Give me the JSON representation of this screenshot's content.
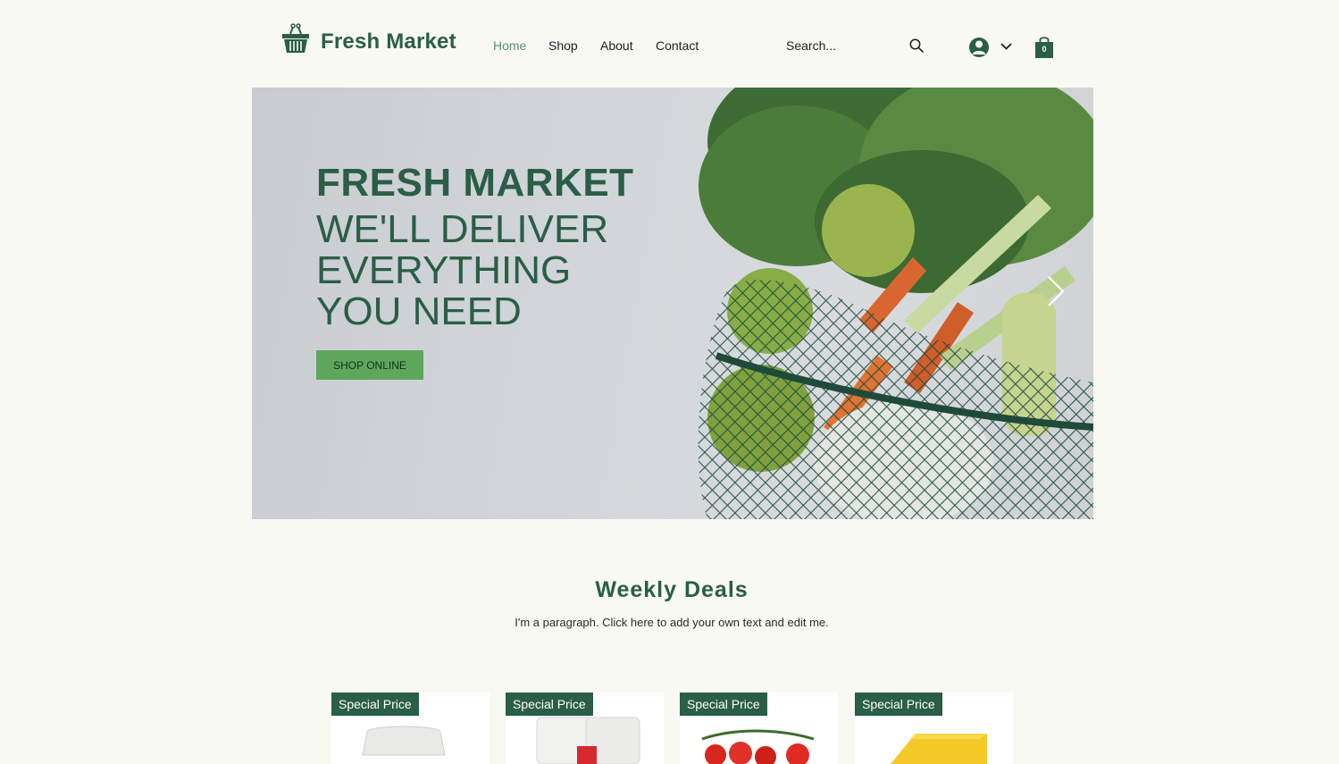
{
  "brand": {
    "name": "Fresh Market",
    "logo_icon": "basket-icon"
  },
  "nav": {
    "items": [
      {
        "label": "Home",
        "active": true
      },
      {
        "label": "Shop",
        "active": false
      },
      {
        "label": "About",
        "active": false
      },
      {
        "label": "Contact",
        "active": false
      }
    ]
  },
  "search": {
    "placeholder": "Search..."
  },
  "account": {
    "icon": "user-avatar-icon"
  },
  "cart": {
    "count": "0",
    "icon": "shopping-bag-icon"
  },
  "hero": {
    "title": "FRESH MARKET",
    "subtitle_lines": [
      "WE'LL DELIVER",
      "EVERYTHING",
      "YOU NEED"
    ],
    "cta_label": "SHOP ONLINE"
  },
  "deals": {
    "title": "Weekly Deals",
    "paragraph": "I'm a paragraph. Click here to add your own text and edit me.",
    "products": [
      {
        "badge": "Special Price",
        "image": "egg-carton"
      },
      {
        "badge": "Special Price",
        "image": "toilet-paper"
      },
      {
        "badge": "Special Price",
        "image": "tomatoes"
      },
      {
        "badge": "Special Price",
        "image": "cheese"
      }
    ]
  },
  "colors": {
    "brand_green": "#2a5e46",
    "button_green": "#5ea65c",
    "page_bg": "#f9f9f3",
    "nav_active": "#5b8c76"
  }
}
